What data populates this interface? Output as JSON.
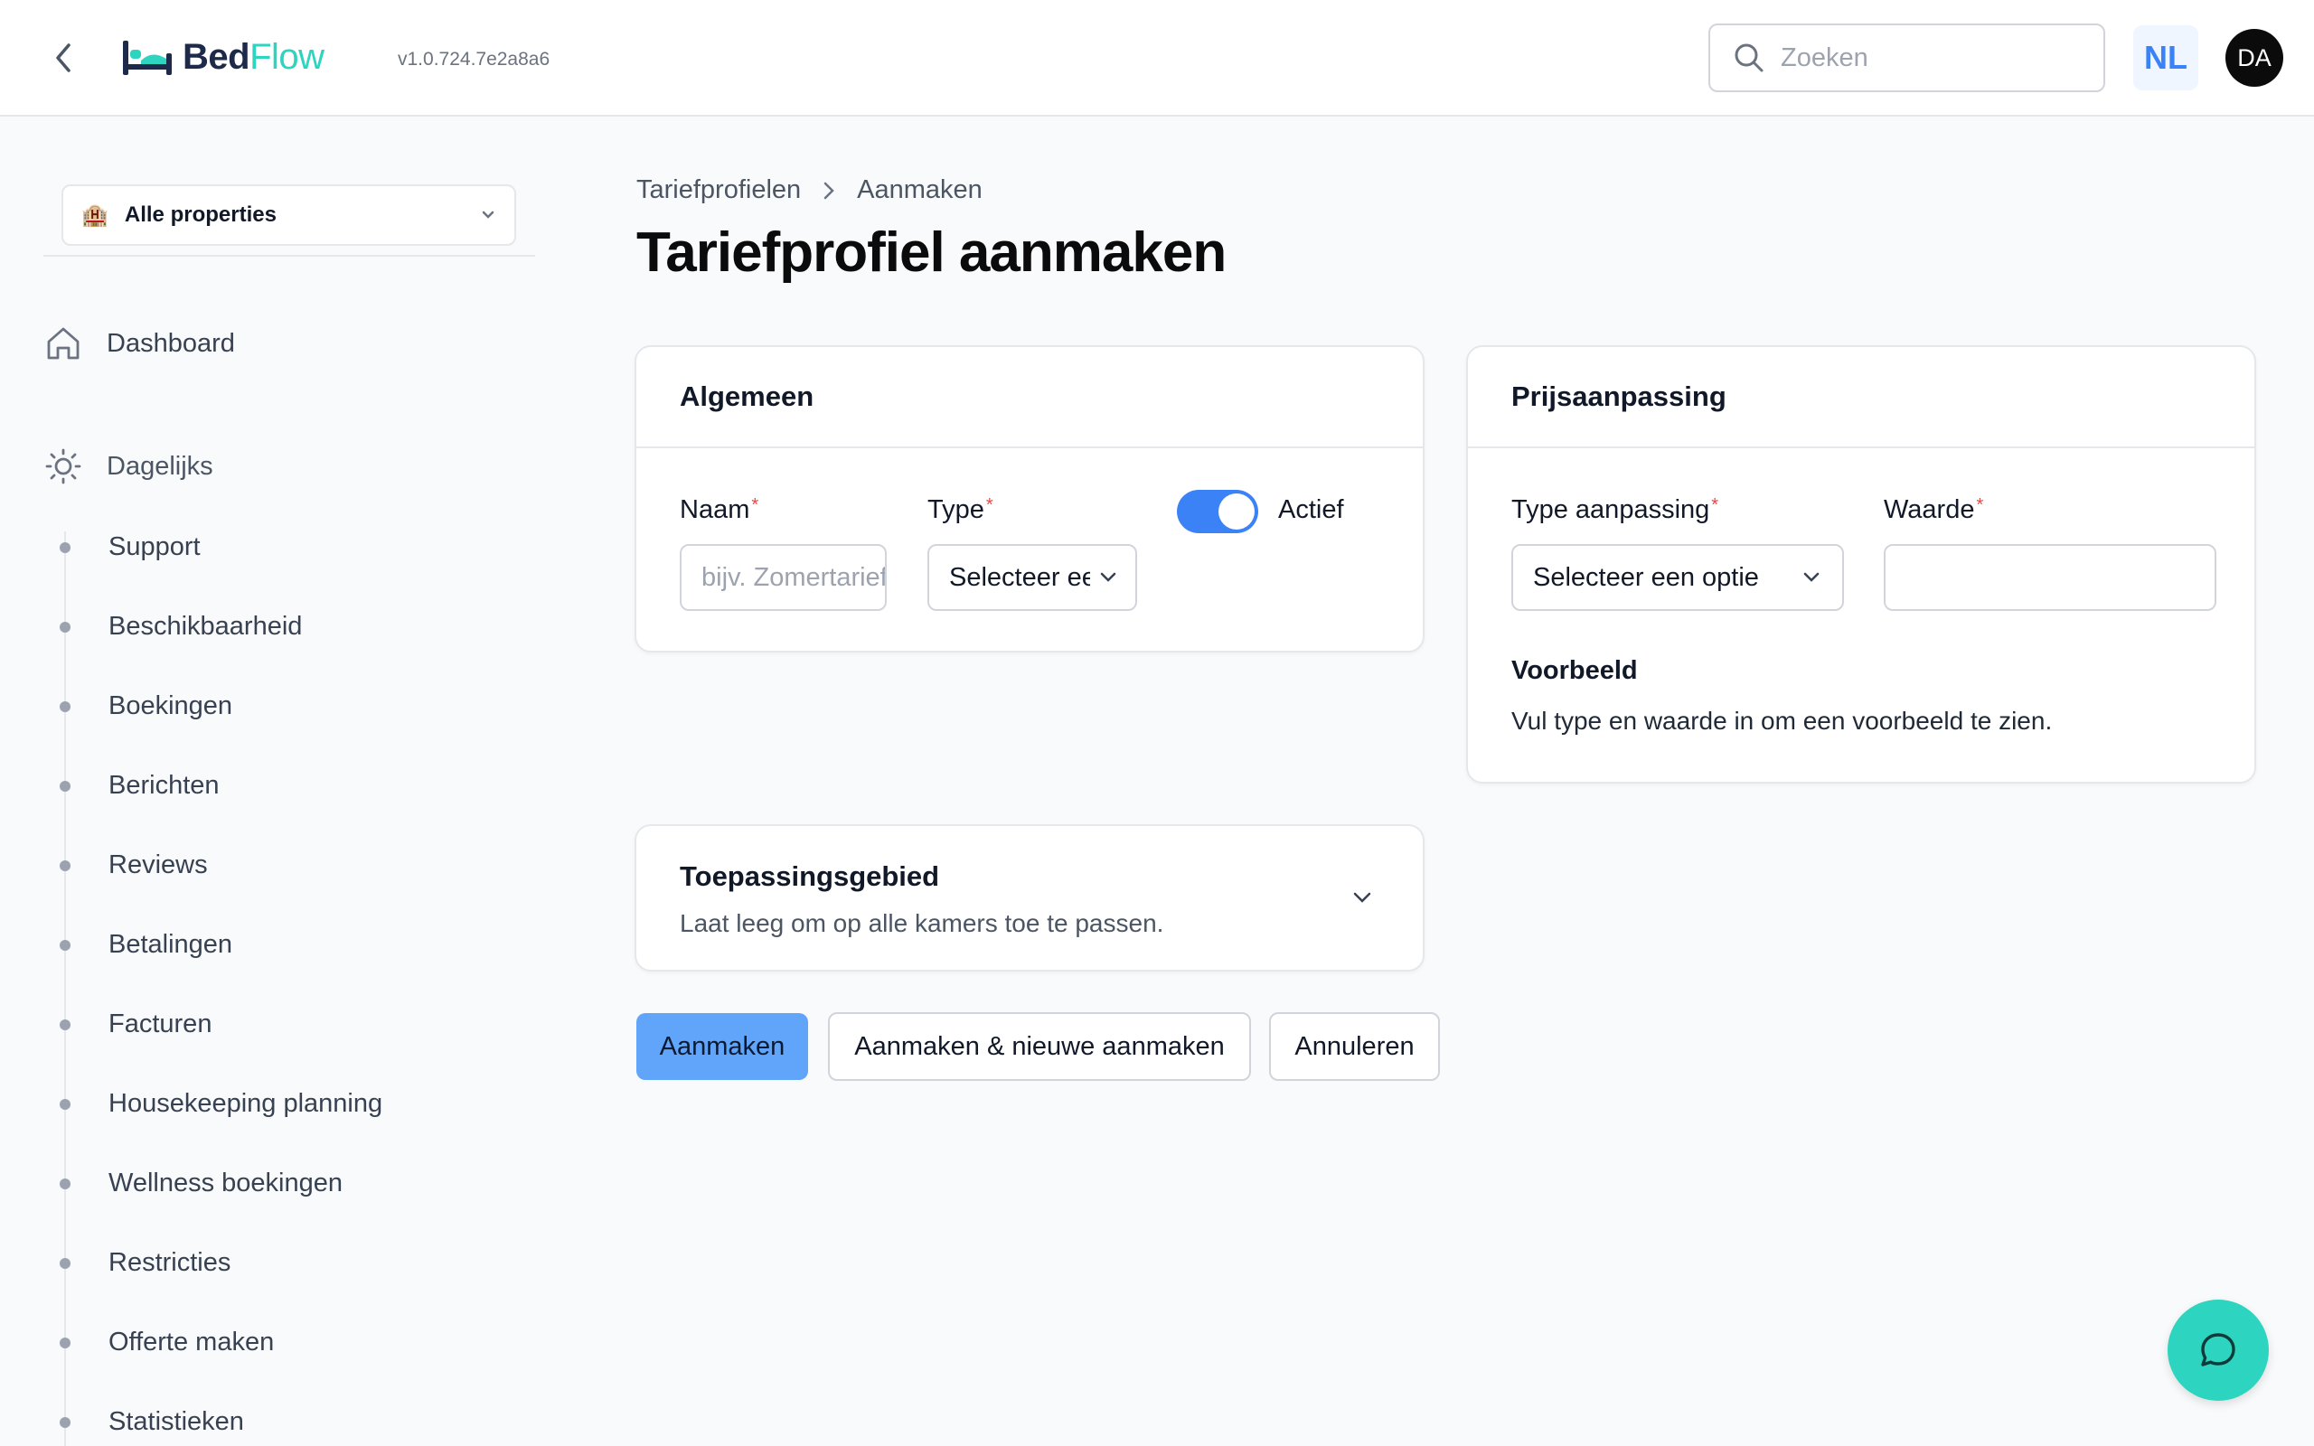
{
  "header": {
    "logo_part1": "Bed",
    "logo_part2": "Flow",
    "version": "v1.0.724.7e2a8a6",
    "search_placeholder": "Zoeken",
    "language": "NL",
    "user_initials": "DA"
  },
  "sidebar": {
    "property_select": "Alle properties",
    "dashboard": "Dashboard",
    "section": "Dagelijks",
    "items": [
      "Support",
      "Beschikbaarheid",
      "Boekingen",
      "Berichten",
      "Reviews",
      "Betalingen",
      "Facturen",
      "Housekeeping planning",
      "Wellness boekingen",
      "Restricties",
      "Offerte maken",
      "Statistieken"
    ]
  },
  "breadcrumb": {
    "parent": "Tariefprofielen",
    "current": "Aanmaken"
  },
  "page_title": "Tariefprofiel aanmaken",
  "general": {
    "title": "Algemeen",
    "name_label": "Naam",
    "name_placeholder": "bijv. Zomertarief",
    "type_label": "Type",
    "type_value": "Selecteer een optie",
    "active_label": "Actief",
    "active": true
  },
  "price": {
    "title": "Prijsaanpassing",
    "adjust_type_label": "Type aanpassing",
    "adjust_type_value": "Selecteer een optie",
    "value_label": "Waarde",
    "value": "",
    "preview_title": "Voorbeeld",
    "preview_text": "Vul type en waarde in om een voorbeeld te zien."
  },
  "scope": {
    "title": "Toepassingsgebied",
    "subtitle": "Laat leeg om op alle kamers toe te passen."
  },
  "actions": {
    "create": "Aanmaken",
    "create_and_new": "Aanmaken & nieuwe aanmaken",
    "cancel": "Annuleren"
  },
  "colors": {
    "primary": "#3b82f6",
    "primary_button": "#60a5fa",
    "brand_teal": "#2dd4bf",
    "brand_navy": "#1e2a4a",
    "required": "#ef4444"
  }
}
